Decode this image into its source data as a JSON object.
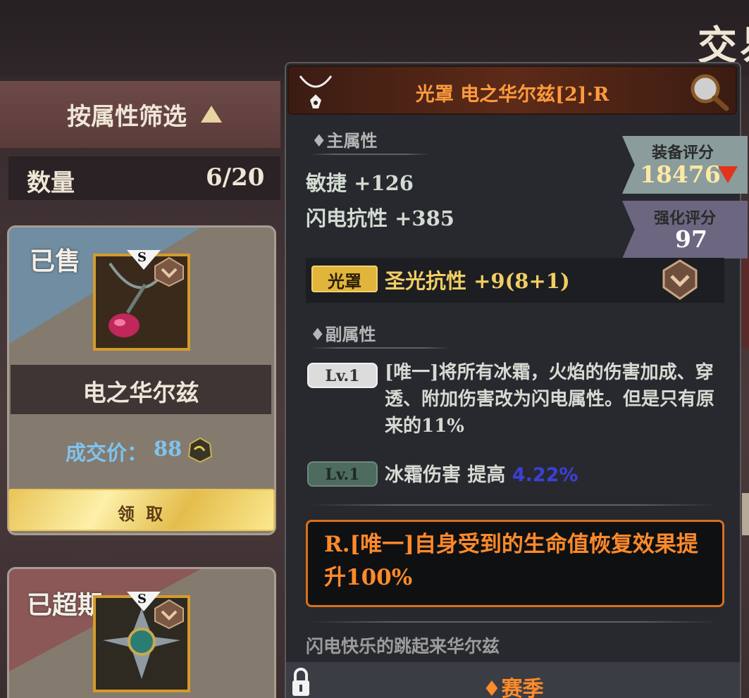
{
  "page": {
    "title": "交易"
  },
  "filter": {
    "label": "按属性筛选",
    "arrow_icon": "triangle-up-icon"
  },
  "quantity": {
    "label": "数量",
    "value": "6/20"
  },
  "cards": [
    {
      "status": "已售",
      "grade": "S",
      "name": "电之华尔兹",
      "price_label": "成交价：",
      "price_value": "88",
      "currency_icon": "gem-currency-icon",
      "claim_label": "领 取"
    },
    {
      "status": "已超期",
      "grade": "S"
    }
  ],
  "tooltip": {
    "title": "光罩 电之华尔兹[2]·R",
    "slot_icon": "necklace-icon",
    "search_icon": "magnifier-icon",
    "main_stats_label": "♦主属性",
    "main_stats": [
      {
        "text": "敏捷 +126"
      },
      {
        "text": "闪电抗性 +385"
      }
    ],
    "score": {
      "label": "装备评分",
      "value": "18476",
      "trend": "down"
    },
    "enhance": {
      "label": "强化评分",
      "value": "97"
    },
    "aura": {
      "chip": "光罩",
      "text": "圣光抗性 +9(8+1)"
    },
    "sub_stats_label": "♦副属性",
    "sub_stats": [
      {
        "level": "Lv.1",
        "text": "[唯一]将所有冰霜，火焰的伤害加成、穿透、附加伤害改为闪电属性。但是只有原来的11%"
      },
      {
        "level": "Lv.1",
        "text": "冰霜伤害 提高 ",
        "value": "4.22%"
      }
    ],
    "unique_effect": "R.[唯一]自身受到的生命值恢复效果提升100%",
    "flavor": "闪电快乐的跳起来华尔兹",
    "season": "♦赛季",
    "lock_icon": "lock-icon"
  },
  "colors": {
    "accent_orange": "#ff8a2a",
    "price_blue": "#7fc3ef",
    "gold": "#e1b53c",
    "down_red": "#e0341d"
  }
}
